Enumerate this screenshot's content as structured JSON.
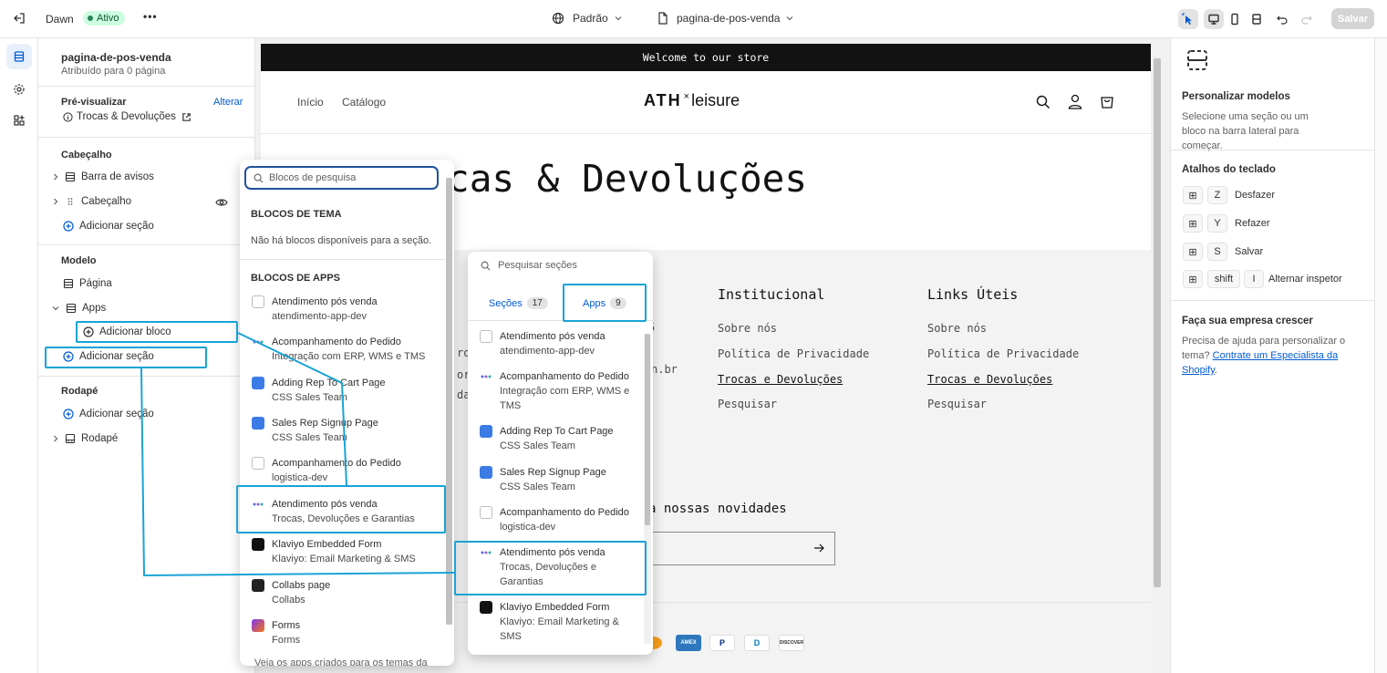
{
  "topbar": {
    "theme_name": "Dawn",
    "status_badge": "Ativo",
    "more_label": "•••",
    "context_label": "Padrão",
    "template_label": "pagina-de-pos-venda",
    "save_label": "Salvar"
  },
  "sidebar": {
    "template_title": "pagina-de-pos-venda",
    "template_subtitle": "Atribuído para 0 página",
    "preview_label": "Pré-visualizar",
    "change_label": "Alterar",
    "preview_page": "Trocas & Devoluções",
    "header_group": "Cabeçalho",
    "announcement_bar": "Barra de avisos",
    "header_item": "Cabeçalho",
    "add_section": "Adicionar seção",
    "template_group": "Modelo",
    "page_item": "Página",
    "apps_item": "Apps",
    "add_block": "Adicionar bloco",
    "add_section_2": "Adicionar seção",
    "footer_group": "Rodapé",
    "add_section_3": "Adicionar seção",
    "footer_item": "Rodapé"
  },
  "preview": {
    "announcement": "Welcome to our store",
    "nav": [
      "Início",
      "Catálogo"
    ],
    "logo_left": "ATH",
    "logo_sup": "×",
    "logo_right": "leisure",
    "page_heading": "Trocas & Devoluções",
    "footer_col1_title": "Institucional",
    "footer_col1_links": [
      "Sobre nós",
      "Política de Privacidade",
      "Trocas e Devoluções",
      "Pesquisar"
    ],
    "footer_col2_title": "Links Úteis",
    "footer_col2_links": [
      "Sobre nós",
      "Política de Privacidade",
      "Trocas e Devoluções",
      "Pesquisar"
    ],
    "frag_5": "5",
    "frag_ro": "ro",
    "frag_or": "or",
    "frag_da": "da",
    "frag_nbr": "n.br",
    "newsletter_frag": "a nossas novidades",
    "payments": [
      "AMEX",
      "P",
      "D",
      "DISCOVER"
    ]
  },
  "block_picker": {
    "search_placeholder": "Blocos de pesquisa",
    "theme_blocks_header": "BLOCOS DE TEMA",
    "no_blocks": "Não há blocos disponíveis para a seção.",
    "app_blocks_header": "BLOCOS DE APPS",
    "items": [
      {
        "title": "Atendimento pós venda",
        "sub": "atendimento-app-dev",
        "icon": "grid-icon"
      },
      {
        "title": "Acompanhamento do Pedido",
        "sub": "Integração com ERP, WMS e TMS",
        "icon": "dots-icon"
      },
      {
        "title": "Adding Rep To Cart Page",
        "sub": "CSS Sales Team",
        "icon": "css-app-icon"
      },
      {
        "title": "Sales Rep Signup Page",
        "sub": "CSS Sales Team",
        "icon": "css-app-icon"
      },
      {
        "title": "Acompanhamento do Pedido",
        "sub": "logistica-dev",
        "icon": "grid-icon"
      },
      {
        "title": "Atendimento pós venda",
        "sub": "Trocas, Devoluções e Garantias",
        "icon": "dots-icon"
      },
      {
        "title": "Klaviyo Embedded Form",
        "sub": "Klaviyo: Email Marketing & SMS",
        "icon": "klaviyo-icon"
      },
      {
        "title": "Collabs page",
        "sub": "Collabs",
        "icon": "collabs-icon"
      },
      {
        "title": "Forms",
        "sub": "Forms",
        "icon": "forms-icon"
      }
    ],
    "footer_text": "Veja os apps criados para os temas da"
  },
  "section_picker": {
    "search_placeholder": "Pesquisar seções",
    "tab_sections": "Seções",
    "tab_sections_count": "17",
    "tab_apps": "Apps",
    "tab_apps_count": "9",
    "items": [
      {
        "title": "Atendimento pós venda",
        "sub": "atendimento-app-dev",
        "icon": "grid-icon"
      },
      {
        "title": "Acompanhamento do Pedido",
        "sub": "Integração com ERP, WMS e TMS",
        "icon": "dots-icon"
      },
      {
        "title": "Adding Rep To Cart Page",
        "sub": "CSS Sales Team",
        "icon": "css-app-icon"
      },
      {
        "title": "Sales Rep Signup Page",
        "sub": "CSS Sales Team",
        "icon": "css-app-icon"
      },
      {
        "title": "Acompanhamento do Pedido",
        "sub": "logistica-dev",
        "icon": "grid-icon"
      },
      {
        "title": "Atendimento pós venda",
        "sub": "Trocas, Devoluções e Garantias",
        "icon": "dots-icon"
      },
      {
        "title": "Klaviyo Embedded Form",
        "sub": "Klaviyo: Email Marketing & SMS",
        "icon": "klaviyo-icon"
      }
    ]
  },
  "right_panel": {
    "title": "Personalizar modelos",
    "desc": "Selecione uma seção ou um bloco na barra lateral para começar.",
    "shortcuts_title": "Atalhos do teclado",
    "shortcuts": [
      {
        "key": "Z",
        "label": "Desfazer"
      },
      {
        "key": "Y",
        "label": "Refazer"
      },
      {
        "key": "S",
        "label": "Salvar"
      },
      {
        "key": "shift",
        "key2": "I",
        "label": "Alternar inspetor"
      }
    ],
    "grow_title": "Faça sua empresa crescer",
    "grow_text": "Precisa de ajuda para personalizar o tema?",
    "grow_link": "Contrate um Especialista da Shopify",
    "grow_end": "."
  },
  "colors": {
    "accent": "#005bd3",
    "highlight": "#1aa3d6",
    "active_badge": "#cdfee1"
  }
}
